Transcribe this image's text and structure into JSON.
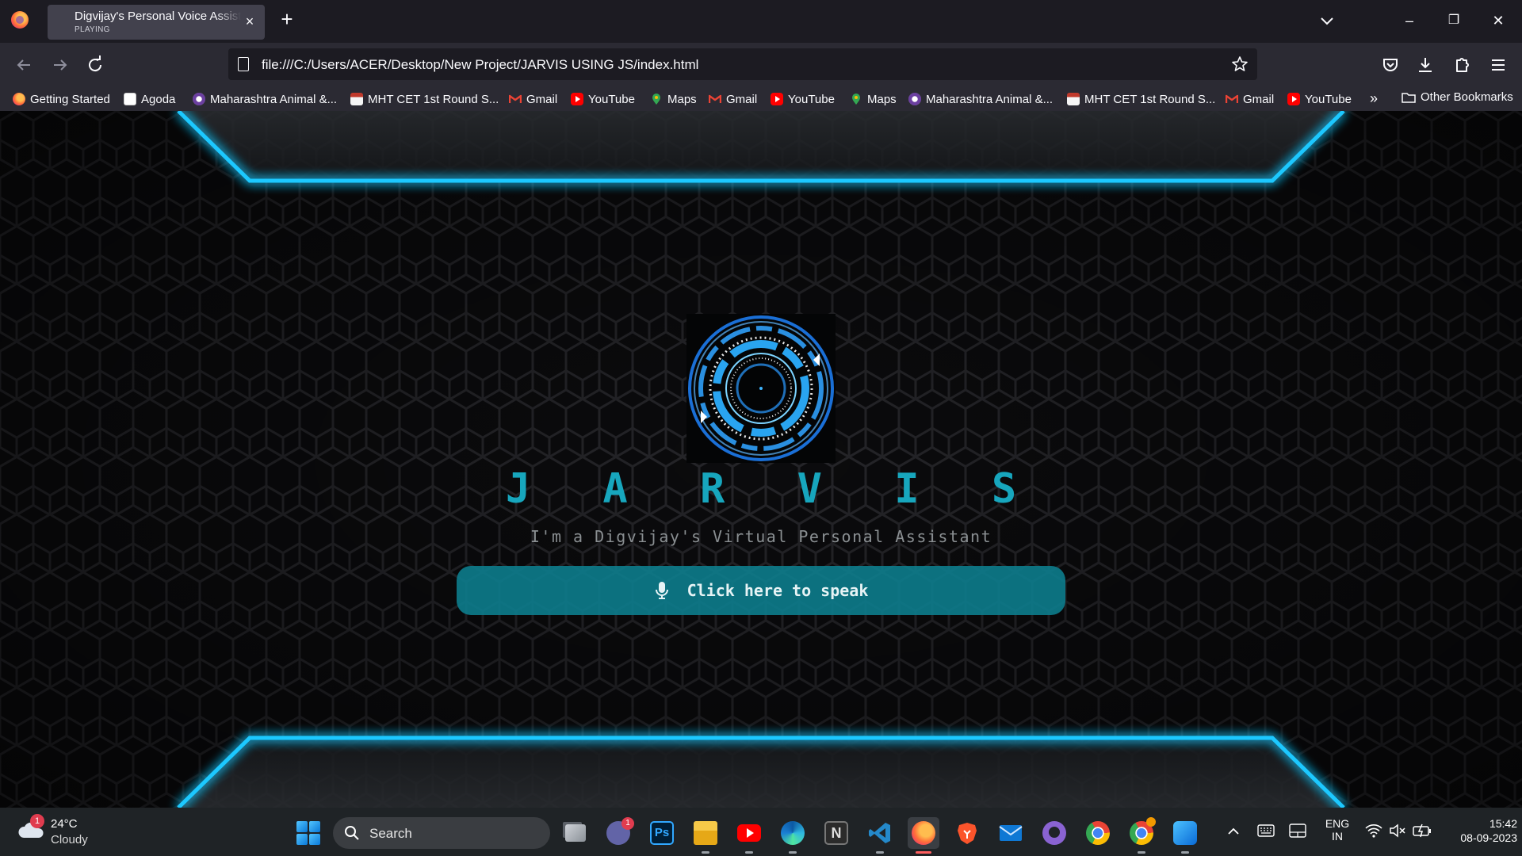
{
  "browser": {
    "tab": {
      "title": "Digvijay's Personal Voice Assistant",
      "status": "PLAYING",
      "close": "×"
    },
    "new_tab": "+",
    "url": "file:///C:/Users/ACER/Desktop/New Project/JARVIS USING JS/index.html",
    "window_controls": {
      "minimize": "–",
      "restore": "❐",
      "close": "✕"
    },
    "bookmarks": [
      {
        "label": "Getting Started",
        "icon": "firefox-icon"
      },
      {
        "label": "Agoda",
        "icon": "agoda-icon"
      },
      {
        "label": "Maharashtra Animal &...",
        "icon": "maharashtra-icon"
      },
      {
        "label": "MHT CET 1st Round S...",
        "icon": "mht-icon"
      },
      {
        "label": "Gmail",
        "icon": "gmail-icon"
      },
      {
        "label": "YouTube",
        "icon": "youtube-icon"
      },
      {
        "label": "Maps",
        "icon": "maps-icon"
      },
      {
        "label": "Gmail",
        "icon": "gmail-icon"
      },
      {
        "label": "YouTube",
        "icon": "youtube-icon"
      },
      {
        "label": "Maps",
        "icon": "maps-icon"
      },
      {
        "label": "Maharashtra Animal &...",
        "icon": "maharashtra-icon"
      },
      {
        "label": "MHT CET 1st Round S...",
        "icon": "mht-icon"
      },
      {
        "label": "Gmail",
        "icon": "gmail-icon"
      },
      {
        "label": "YouTube",
        "icon": "youtube-icon"
      }
    ],
    "bookmarks_more": "»",
    "other_bookmarks": "Other Bookmarks"
  },
  "page": {
    "title": "J A R V I S",
    "subtitle": "I'm a Digvijay's Virtual Personal Assistant",
    "speak_button": "Click here to speak",
    "colors": {
      "accent": "#17a6bd",
      "button": "#0d808f",
      "frame_glow": "#1ec8ff"
    }
  },
  "taskbar": {
    "weather": {
      "temp": "24°C",
      "condition": "Cloudy",
      "badge": "1"
    },
    "search_label": "Search",
    "apps": [
      {
        "name": "task-view-icon"
      },
      {
        "name": "teams-chat-icon",
        "badge": "1"
      },
      {
        "name": "photoshop-icon",
        "text": "Ps"
      },
      {
        "name": "file-explorer-icon"
      },
      {
        "name": "youtube-app-icon"
      },
      {
        "name": "edge-icon"
      },
      {
        "name": "notion-icon",
        "text": "N"
      },
      {
        "name": "vscode-icon"
      },
      {
        "name": "firefox-icon"
      },
      {
        "name": "brave-icon"
      },
      {
        "name": "mail-icon"
      },
      {
        "name": "github-icon"
      },
      {
        "name": "chrome-icon"
      },
      {
        "name": "chrome-canary-icon"
      },
      {
        "name": "paint-icon"
      }
    ],
    "language": {
      "line1": "ENG",
      "line2": "IN"
    },
    "clock": {
      "time": "15:42",
      "date": "08-09-2023"
    }
  }
}
